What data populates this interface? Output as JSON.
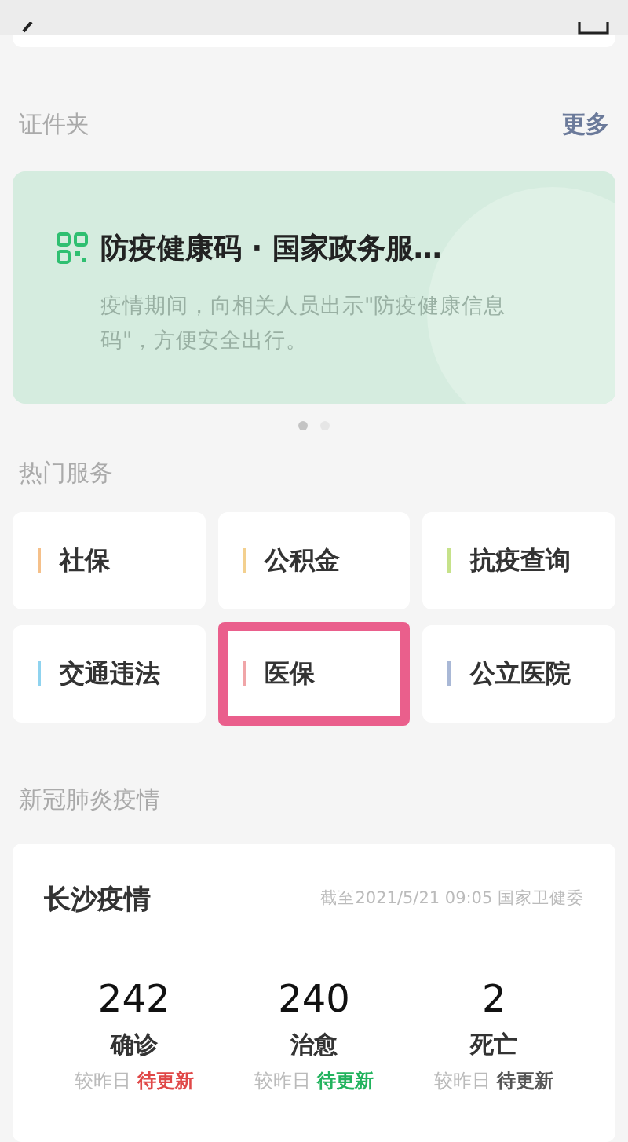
{
  "documents": {
    "title": "证件夹",
    "more": "更多",
    "card": {
      "title": "防疫健康码 · 国家政务服…",
      "description": "疫情期间，向相关人员出示\"防疫健康信息码\"，方便安全出行。"
    },
    "pager": [
      {
        "selected": true
      },
      {
        "selected": false
      }
    ]
  },
  "hot_services": {
    "title": "热门服务",
    "items": [
      {
        "label": "社保",
        "color": "#f5c08a",
        "highlighted": false
      },
      {
        "label": "公积金",
        "color": "#f3d08f",
        "highlighted": false
      },
      {
        "label": "抗疫查询",
        "color": "#c6e28a",
        "highlighted": false
      },
      {
        "label": "交通违法",
        "color": "#8fd3ef",
        "highlighted": false
      },
      {
        "label": "医保",
        "color": "#f0a5a8",
        "highlighted": true
      },
      {
        "label": "公立医院",
        "color": "#a9b8d6",
        "highlighted": false
      }
    ]
  },
  "covid": {
    "title": "新冠肺炎疫情",
    "card": {
      "city": "长沙疫情",
      "source": "截至2021/5/21 09:05 国家卫健委",
      "stats": [
        {
          "value": "242",
          "label": "确诊",
          "compare": "较昨日",
          "update": "待更新",
          "color": "#e04848"
        },
        {
          "value": "240",
          "label": "治愈",
          "compare": "较昨日",
          "update": "待更新",
          "color": "#22b35e"
        },
        {
          "value": "2",
          "label": "死亡",
          "compare": "较昨日",
          "update": "待更新",
          "color": "#555555"
        }
      ]
    }
  }
}
